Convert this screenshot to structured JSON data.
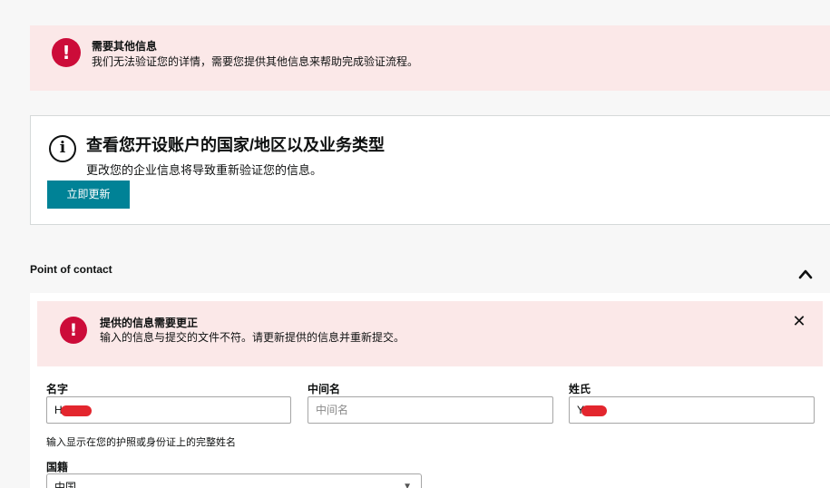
{
  "top_alert": {
    "title": "需要其他信息",
    "message": "我们无法验证您的详情，需要您提供其他信息来帮助完成验证流程。"
  },
  "info_card": {
    "title": "查看您开设账户的国家/地区以及业务类型",
    "message": "更改您的企业信息将导致重新验证您的信息。",
    "button_label": "立即更新"
  },
  "section": {
    "title": "Point of contact"
  },
  "inner_alert": {
    "title": "提供的信息需要更正",
    "message": "输入的信息与提交的文件不符。请更新提供的信息并重新提交。",
    "close_glyph": "✕"
  },
  "form": {
    "first_name": {
      "label": "名字",
      "value": "H"
    },
    "middle_name": {
      "label": "中间名",
      "placeholder": "中间名"
    },
    "last_name": {
      "label": "姓氏",
      "value": "Y"
    },
    "hint": "输入显示在您的护照或身份证上的完整姓名",
    "nationality": {
      "label": "国籍",
      "value": "中国"
    }
  },
  "colors": {
    "error": "#cc0c39",
    "alert_bg": "#fbe8e8",
    "button": "#008296"
  }
}
